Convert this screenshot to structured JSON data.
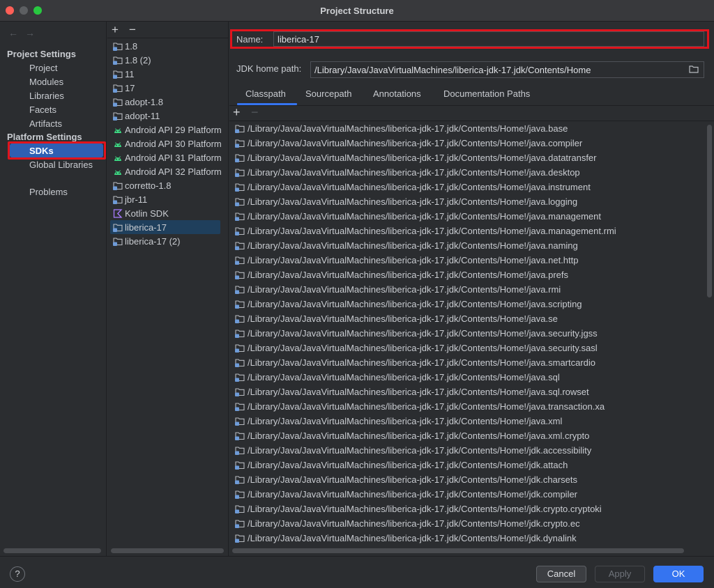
{
  "window": {
    "title": "Project Structure"
  },
  "nav": {
    "back_icon": "arrow-left-icon",
    "forward_icon": "arrow-right-icon",
    "project_heading": "Project Settings",
    "project_items": [
      "Project",
      "Modules",
      "Libraries",
      "Facets",
      "Artifacts"
    ],
    "platform_heading": "Platform Settings",
    "platform_items": [
      "SDKs",
      "Global Libraries"
    ],
    "problems": "Problems"
  },
  "sdk_list": {
    "add_label": "+",
    "remove_label": "−",
    "items": [
      {
        "label": "1.8",
        "icon": "jdk-folder-icon"
      },
      {
        "label": "1.8 (2)",
        "icon": "jdk-folder-icon"
      },
      {
        "label": "11",
        "icon": "jdk-folder-icon"
      },
      {
        "label": "17",
        "icon": "jdk-folder-icon"
      },
      {
        "label": "adopt-1.8",
        "icon": "jdk-folder-icon"
      },
      {
        "label": "adopt-11",
        "icon": "jdk-folder-icon"
      },
      {
        "label": "Android API 29 Platform",
        "icon": "android-icon"
      },
      {
        "label": "Android API 30 Platform",
        "icon": "android-icon"
      },
      {
        "label": "Android API 31 Platform",
        "icon": "android-icon"
      },
      {
        "label": "Android API 32 Platform",
        "icon": "android-icon"
      },
      {
        "label": "corretto-1.8",
        "icon": "jdk-folder-icon"
      },
      {
        "label": "jbr-11",
        "icon": "jdk-folder-icon"
      },
      {
        "label": "Kotlin SDK",
        "icon": "kotlin-icon"
      },
      {
        "label": "liberica-17",
        "icon": "jdk-folder-icon"
      },
      {
        "label": "liberica-17 (2)",
        "icon": "jdk-folder-icon"
      }
    ],
    "selected": "liberica-17"
  },
  "form": {
    "name_label": "Name:",
    "name_value": "liberica-17",
    "jdk_label": "JDK home path:",
    "jdk_value": "/Library/Java/JavaVirtualMachines/liberica-jdk-17.jdk/Contents/Home",
    "browse_icon": "folder-icon"
  },
  "tabs": [
    "Classpath",
    "Sourcepath",
    "Annotations",
    "Documentation Paths"
  ],
  "active_tab": "Classpath",
  "classpath": {
    "add_label": "+",
    "remove_label": "−",
    "prefix": "/Library/Java/JavaVirtualMachines/liberica-jdk-17.jdk/Contents/Home!/",
    "entries": [
      "/Library/Java/JavaVirtualMachines/liberica-jdk-17.jdk/Contents/Home!/java.base",
      "/Library/Java/JavaVirtualMachines/liberica-jdk-17.jdk/Contents/Home!/java.compiler",
      "/Library/Java/JavaVirtualMachines/liberica-jdk-17.jdk/Contents/Home!/java.datatransfer",
      "/Library/Java/JavaVirtualMachines/liberica-jdk-17.jdk/Contents/Home!/java.desktop",
      "/Library/Java/JavaVirtualMachines/liberica-jdk-17.jdk/Contents/Home!/java.instrument",
      "/Library/Java/JavaVirtualMachines/liberica-jdk-17.jdk/Contents/Home!/java.logging",
      "/Library/Java/JavaVirtualMachines/liberica-jdk-17.jdk/Contents/Home!/java.management",
      "/Library/Java/JavaVirtualMachines/liberica-jdk-17.jdk/Contents/Home!/java.management.rmi",
      "/Library/Java/JavaVirtualMachines/liberica-jdk-17.jdk/Contents/Home!/java.naming",
      "/Library/Java/JavaVirtualMachines/liberica-jdk-17.jdk/Contents/Home!/java.net.http",
      "/Library/Java/JavaVirtualMachines/liberica-jdk-17.jdk/Contents/Home!/java.prefs",
      "/Library/Java/JavaVirtualMachines/liberica-jdk-17.jdk/Contents/Home!/java.rmi",
      "/Library/Java/JavaVirtualMachines/liberica-jdk-17.jdk/Contents/Home!/java.scripting",
      "/Library/Java/JavaVirtualMachines/liberica-jdk-17.jdk/Contents/Home!/java.se",
      "/Library/Java/JavaVirtualMachines/liberica-jdk-17.jdk/Contents/Home!/java.security.jgss",
      "/Library/Java/JavaVirtualMachines/liberica-jdk-17.jdk/Contents/Home!/java.security.sasl",
      "/Library/Java/JavaVirtualMachines/liberica-jdk-17.jdk/Contents/Home!/java.smartcardio",
      "/Library/Java/JavaVirtualMachines/liberica-jdk-17.jdk/Contents/Home!/java.sql",
      "/Library/Java/JavaVirtualMachines/liberica-jdk-17.jdk/Contents/Home!/java.sql.rowset",
      "/Library/Java/JavaVirtualMachines/liberica-jdk-17.jdk/Contents/Home!/java.transaction.xa",
      "/Library/Java/JavaVirtualMachines/liberica-jdk-17.jdk/Contents/Home!/java.xml",
      "/Library/Java/JavaVirtualMachines/liberica-jdk-17.jdk/Contents/Home!/java.xml.crypto",
      "/Library/Java/JavaVirtualMachines/liberica-jdk-17.jdk/Contents/Home!/jdk.accessibility",
      "/Library/Java/JavaVirtualMachines/liberica-jdk-17.jdk/Contents/Home!/jdk.attach",
      "/Library/Java/JavaVirtualMachines/liberica-jdk-17.jdk/Contents/Home!/jdk.charsets",
      "/Library/Java/JavaVirtualMachines/liberica-jdk-17.jdk/Contents/Home!/jdk.compiler",
      "/Library/Java/JavaVirtualMachines/liberica-jdk-17.jdk/Contents/Home!/jdk.crypto.cryptoki",
      "/Library/Java/JavaVirtualMachines/liberica-jdk-17.jdk/Contents/Home!/jdk.crypto.ec",
      "/Library/Java/JavaVirtualMachines/liberica-jdk-17.jdk/Contents/Home!/jdk.dynalink"
    ]
  },
  "footer": {
    "help_label": "?",
    "cancel_label": "Cancel",
    "apply_label": "Apply",
    "ok_label": "OK"
  },
  "colors": {
    "accent": "#3574f0",
    "selection": "#2e5fb3",
    "highlight_box": "#e0141d",
    "android": "#3ddc84",
    "jdk_folder": "#6e9bd8"
  }
}
